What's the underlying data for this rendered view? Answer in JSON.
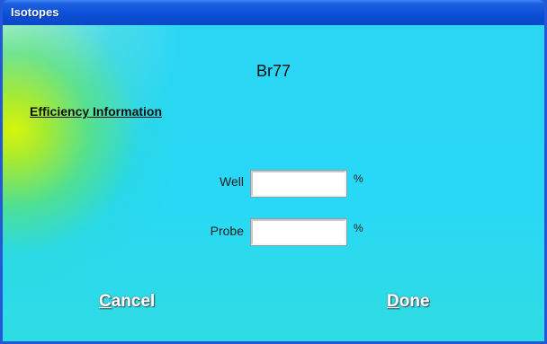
{
  "window": {
    "title": "Isotopes"
  },
  "isotope": {
    "name": "Br77"
  },
  "efficiency": {
    "heading": "Efficiency Information",
    "fields": [
      {
        "label": "Well",
        "value": "",
        "unit": "%"
      },
      {
        "label": "Probe",
        "value": "",
        "unit": "%"
      }
    ]
  },
  "buttons": {
    "cancel": {
      "mnemonic": "C",
      "rest": "ancel"
    },
    "done": {
      "mnemonic": "D",
      "rest": "one"
    }
  }
}
